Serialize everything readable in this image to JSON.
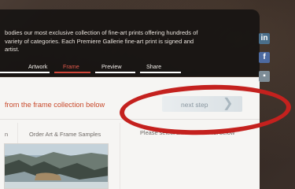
{
  "intro": {
    "line1": "bodies our most exclusive collection of fine-art prints offering hundreds of",
    "line2": "variety of categories. Each Premiere Gallerie fine-art print is signed and",
    "line3": "artist."
  },
  "tabs": [
    {
      "label": "Artwork",
      "active": false
    },
    {
      "label": "Frame",
      "active": true
    },
    {
      "label": "Preview",
      "active": false
    },
    {
      "label": "Share",
      "active": false
    }
  ],
  "section_heading": "from the frame collection below",
  "next_step": {
    "label": "next step"
  },
  "columns": {
    "left_label": "n",
    "middle_label": "Order Art & Frame Samples",
    "right_label": "Please select a frame from list below"
  },
  "social": [
    {
      "icon": "linkedin-icon",
      "glyph": "in"
    },
    {
      "icon": "facebook-icon",
      "glyph": "f"
    },
    {
      "icon": "social-icon",
      "glyph": "▪"
    }
  ],
  "colors": {
    "accent": "#d2483c",
    "annotation": "#c4211e"
  }
}
